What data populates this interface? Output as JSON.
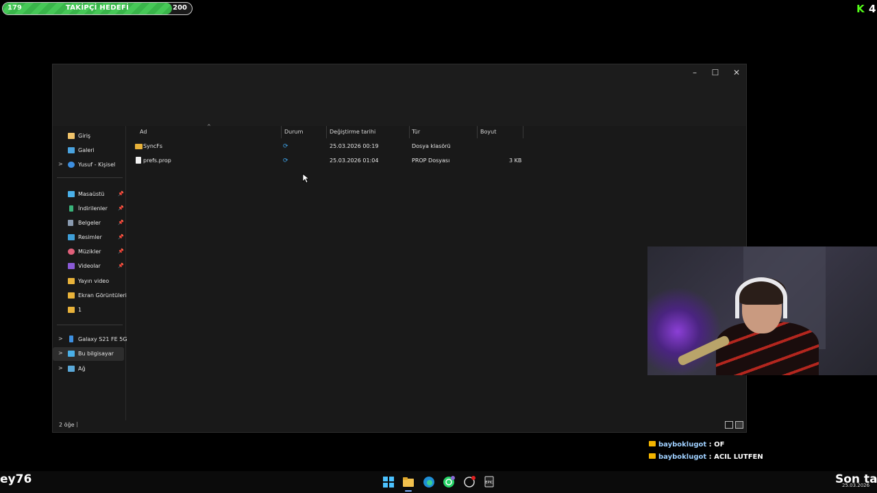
{
  "goal": {
    "current": "179",
    "title": "TAKİPÇİ HEDEFİ",
    "target": "200",
    "progress": 0.895
  },
  "kick": {
    "logo": "K",
    "count": "4"
  },
  "window": {
    "minimize": "–",
    "maximize": "☐",
    "close": "✕"
  },
  "nav": {
    "top": [
      {
        "label": "Giriş",
        "icon": "home-icon"
      },
      {
        "label": "Galeri",
        "icon": "gallery-icon"
      },
      {
        "label": "Yusuf - Kişisel",
        "icon": "onedrive-icon",
        "expandable": true
      }
    ],
    "pinned": [
      {
        "label": "Masaüstü",
        "icon": "desktop-icon"
      },
      {
        "label": "İndirilenler",
        "icon": "download-icon"
      },
      {
        "label": "Belgeler",
        "icon": "documents-icon"
      },
      {
        "label": "Resimler",
        "icon": "pictures-icon"
      },
      {
        "label": "Müzikler",
        "icon": "music-icon"
      },
      {
        "label": "Videolar",
        "icon": "videos-icon"
      }
    ],
    "folders": [
      {
        "label": "Yayın video",
        "icon": "folder-icon"
      },
      {
        "label": "Ekran Görüntüleri",
        "icon": "folder-icon"
      },
      {
        "label": "1",
        "icon": "folder-icon"
      }
    ],
    "devices": [
      {
        "label": "Galaxy S21 FE 5G",
        "icon": "phone-icon"
      },
      {
        "label": "Bu bilgisayar",
        "icon": "computer-icon"
      },
      {
        "label": "Ağ",
        "icon": "network-icon"
      }
    ]
  },
  "columns": {
    "name": "Ad",
    "status": "Durum",
    "modified": "Değiştirme tarihi",
    "type": "Tür",
    "size": "Boyut"
  },
  "files": [
    {
      "name": "SyncFs",
      "modified": "25.03.2026 00:19",
      "type": "Dosya klasörü",
      "size": "",
      "kind": "folder"
    },
    {
      "name": "prefs.prop",
      "modified": "25.03.2026 01:04",
      "type": "PROP Dosyası",
      "size": "3 KB",
      "kind": "file"
    }
  ],
  "status": {
    "count": "2 öğe",
    "cursor": "|"
  },
  "chat": [
    {
      "user": "bayboklugot",
      "message": ": OF"
    },
    {
      "user": "bayboklugot",
      "message": ": ACIL LUTFEN"
    }
  ],
  "ticker": {
    "left": "ey76",
    "right": "Son tak"
  },
  "taskbar": {
    "date": "25.03.2026"
  }
}
